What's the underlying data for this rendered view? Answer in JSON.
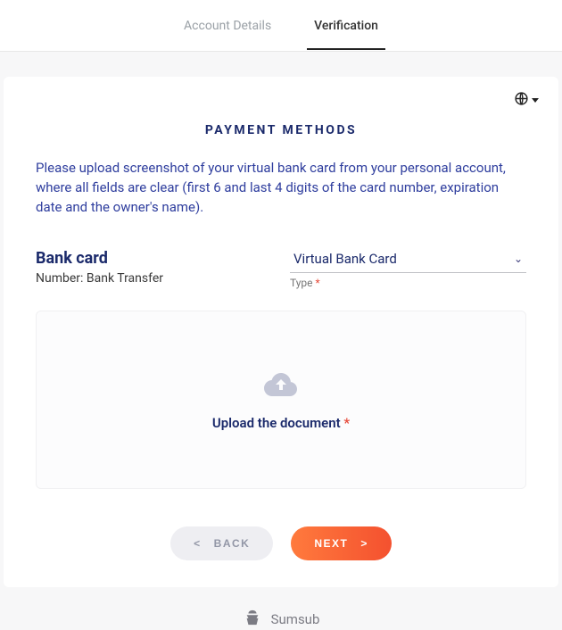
{
  "tabs": {
    "account": "Account Details",
    "verification": "Verification"
  },
  "title": "PAYMENT METHODS",
  "intro": "Please upload screenshot of your virtual bank card from your personal account, where all fields are clear (first 6 and last 4 digits of the card number, expiration date and the owner's name).",
  "section": {
    "heading": "Bank card",
    "number_label": "Number: Bank Transfer"
  },
  "type_field": {
    "value": "Virtual Bank Card",
    "label": "Type",
    "required_mark": "*"
  },
  "dropzone": {
    "label": "Upload the document",
    "required_mark": "*"
  },
  "buttons": {
    "back_arrow": "<",
    "back": "BACK",
    "next": "NEXT",
    "next_arrow": ">"
  },
  "footer": {
    "brand": "Sumsub"
  }
}
